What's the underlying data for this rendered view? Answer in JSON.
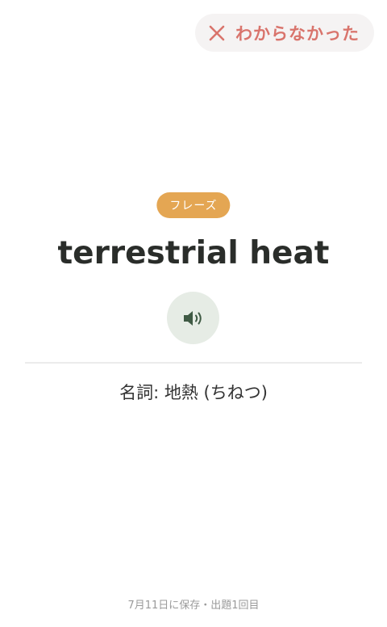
{
  "header": {
    "dont_know_label": "わからなかった",
    "dont_know_icon": "close-icon"
  },
  "card": {
    "tag": "フレーズ",
    "term": "terrestrial heat",
    "audio_icon": "speaker-icon",
    "definition": "名詞: 地熱 (ちねつ)"
  },
  "footer": {
    "meta": "7月11日に保存・出題1回目"
  },
  "colors": {
    "accent_red": "#d9746c",
    "tag_orange": "#e4a653",
    "speaker_bg": "#e6ece5",
    "speaker_icon": "#3f5a44"
  }
}
